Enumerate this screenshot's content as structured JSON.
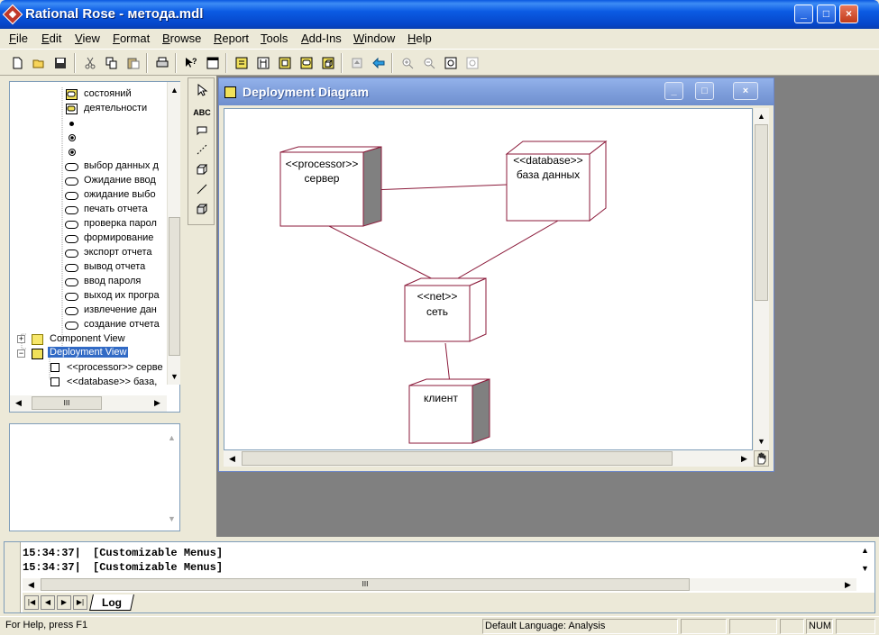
{
  "app": {
    "title": "Rational Rose - метода.mdl",
    "caption_minimize": "_",
    "caption_maximize": "□",
    "caption_close": "×"
  },
  "menu": [
    "File",
    "Edit",
    "View",
    "Format",
    "Browse",
    "Report",
    "Tools",
    "Add-Ins",
    "Window",
    "Help"
  ],
  "browser": {
    "items": [
      {
        "label": "состояний",
        "icon": "statechart-diagram-icon"
      },
      {
        "label": "деятельности",
        "icon": "activity-diagram-icon"
      },
      {
        "label": "",
        "icon": "initial-state-icon"
      },
      {
        "label": "",
        "icon": "final-state-icon"
      },
      {
        "label": "",
        "icon": "final-state-icon"
      },
      {
        "label": "выбор данных д",
        "icon": "state-icon"
      },
      {
        "label": "Ожидание ввод",
        "icon": "state-icon"
      },
      {
        "label": "ожидание выбо",
        "icon": "state-icon"
      },
      {
        "label": "печать отчета",
        "icon": "state-icon"
      },
      {
        "label": "проверка парол",
        "icon": "state-icon"
      },
      {
        "label": "формирование",
        "icon": "state-icon"
      },
      {
        "label": "экспорт отчета",
        "icon": "state-icon"
      },
      {
        "label": "вывод отчета",
        "icon": "state-icon"
      },
      {
        "label": "ввод пароля",
        "icon": "state-icon"
      },
      {
        "label": "выход их програ",
        "icon": "state-icon"
      },
      {
        "label": "извлечение дан",
        "icon": "state-icon"
      },
      {
        "label": "создание отчета",
        "icon": "state-icon"
      }
    ],
    "component_view": "Component View",
    "deployment_view": "Deployment View",
    "deploy_children": [
      "<<processor>> серве",
      "<<database>> база,"
    ],
    "scroll_mark": "III"
  },
  "toolbox": {
    "text_tool": "ABC"
  },
  "diagram": {
    "title": "Deployment Diagram",
    "nodes": {
      "processor_stereo": "<<processor>>",
      "processor_name": "сервер",
      "database_stereo": "<<database>>",
      "database_name": "база данных",
      "net_stereo": "<<net>>",
      "net_name": "сеть",
      "client_name": "клиент"
    }
  },
  "log": {
    "lines": [
      {
        "time": "15:34:37|",
        "text": "[Customizable Menus]"
      },
      {
        "time": "15:34:37|",
        "text": "[Customizable Menus]"
      }
    ],
    "tab": "Log",
    "scroll_mark": "III"
  },
  "status": {
    "help": "For Help, press F1",
    "language": "Default Language: Analysis",
    "num": "NUM"
  },
  "colors": {
    "node_border": "#8b1a3a",
    "node_shade": "#808080",
    "connector": "#8b1a3a",
    "titlebar": "#0b5be3",
    "selection": "#316ac5"
  }
}
